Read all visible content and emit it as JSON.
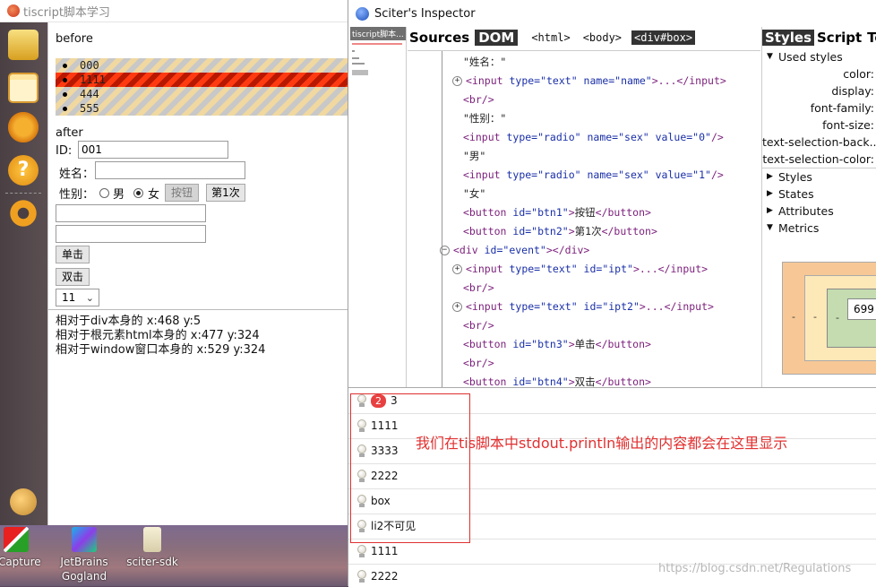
{
  "app": {
    "title": "tiscript脚本学习",
    "before_label": "before",
    "list_items": [
      "000",
      "1111",
      "444",
      "555"
    ],
    "after_label": "after",
    "id_label": "ID:",
    "id_value": "001",
    "name_label": "姓名：",
    "sex_label": "性别：",
    "sex_male": "男",
    "sex_female": "女",
    "btn1_label": "按钮",
    "btn2_label": "第1次",
    "single_click": "单击",
    "double_click": "双击",
    "select_value": "11",
    "log_lines": [
      "相对于div本身的 x:468 y:5",
      "相对于根元素html本身的 x:477 y:324",
      "相对于window窗口本身的 x:529 y:324"
    ]
  },
  "desktop_icons": [
    "SCapture",
    "JetBrains\nGogland",
    "sciter-sdk"
  ],
  "inspector": {
    "title": "Sciter's Inspector",
    "thumb_header": "tiscript脚本...",
    "tabs": {
      "sources": "Sources",
      "dom": "DOM"
    },
    "breadcrumbs": [
      "<html>",
      "<body>",
      "<div#box>"
    ],
    "dom_rows": [
      {
        "indent": 0,
        "expand": false,
        "parts": [
          [
            "text",
            "\"姓名：\""
          ]
        ]
      },
      {
        "indent": 0,
        "expand": true,
        "parts": [
          [
            "tag",
            "<input "
          ],
          [
            "attr",
            "type=\"text\" name=\"name\""
          ],
          [
            "tag",
            ">...</input>"
          ]
        ]
      },
      {
        "indent": 0,
        "expand": false,
        "parts": [
          [
            "tag",
            "<br/>"
          ]
        ]
      },
      {
        "indent": 0,
        "expand": false,
        "parts": [
          [
            "text",
            "\"性别：\""
          ]
        ]
      },
      {
        "indent": 0,
        "expand": false,
        "parts": [
          [
            "tag",
            "<input "
          ],
          [
            "attr",
            "type=\"radio\" name=\"sex\" value=\"0\""
          ],
          [
            "tag",
            "/>"
          ]
        ]
      },
      {
        "indent": 0,
        "expand": false,
        "parts": [
          [
            "text",
            "\"男\""
          ]
        ]
      },
      {
        "indent": 0,
        "expand": false,
        "parts": [
          [
            "tag",
            "<input "
          ],
          [
            "attr",
            "type=\"radio\" name=\"sex\" value=\"1\""
          ],
          [
            "tag",
            "/>"
          ]
        ]
      },
      {
        "indent": 0,
        "expand": false,
        "parts": [
          [
            "text",
            "\"女\""
          ]
        ]
      },
      {
        "indent": 0,
        "expand": false,
        "parts": [
          [
            "tag",
            "<button "
          ],
          [
            "attr",
            "id=\"btn1\""
          ],
          [
            "tag",
            ">"
          ],
          [
            "text",
            "按钮"
          ],
          [
            "tag",
            "</button>"
          ]
        ]
      },
      {
        "indent": 0,
        "expand": false,
        "parts": [
          [
            "tag",
            "<button "
          ],
          [
            "attr",
            "id=\"btn2\""
          ],
          [
            "tag",
            ">"
          ],
          [
            "text",
            "第1次"
          ],
          [
            "tag",
            "</button>"
          ]
        ]
      },
      {
        "indent": -1,
        "expand": "minus",
        "parts": [
          [
            "tag",
            "<div "
          ],
          [
            "attr",
            "id=\"event\""
          ],
          [
            "tag",
            "></div>"
          ]
        ]
      },
      {
        "indent": 0,
        "expand": true,
        "parts": [
          [
            "tag",
            "<input "
          ],
          [
            "attr",
            "type=\"text\" id=\"ipt\""
          ],
          [
            "tag",
            ">...</input>"
          ]
        ]
      },
      {
        "indent": 0,
        "expand": false,
        "parts": [
          [
            "tag",
            "<br/>"
          ]
        ]
      },
      {
        "indent": 0,
        "expand": true,
        "parts": [
          [
            "tag",
            "<input "
          ],
          [
            "attr",
            "type=\"text\" id=\"ipt2\""
          ],
          [
            "tag",
            ">...</input>"
          ]
        ]
      },
      {
        "indent": 0,
        "expand": false,
        "parts": [
          [
            "tag",
            "<br/>"
          ]
        ]
      },
      {
        "indent": 0,
        "expand": false,
        "parts": [
          [
            "tag",
            "<button "
          ],
          [
            "attr",
            "id=\"btn3\""
          ],
          [
            "tag",
            ">"
          ],
          [
            "text",
            "单击"
          ],
          [
            "tag",
            "</button>"
          ]
        ]
      },
      {
        "indent": 0,
        "expand": false,
        "parts": [
          [
            "tag",
            "<br/>"
          ]
        ]
      },
      {
        "indent": 0,
        "expand": false,
        "parts": [
          [
            "tag",
            "<button "
          ],
          [
            "attr",
            "id=\"btn4\""
          ],
          [
            "tag",
            ">"
          ],
          [
            "text",
            "双击"
          ],
          [
            "tag",
            "</button>"
          ]
        ]
      }
    ],
    "styles_tabs": [
      "Styles",
      "Script",
      "Tes"
    ],
    "used_styles_label": "Used styles",
    "used_props": [
      "color:",
      "display:",
      "font-family:",
      "font-size:",
      "text-selection-back...",
      "text-selection-color:"
    ],
    "sections": [
      "Styles",
      "States",
      "Attributes",
      "Metrics"
    ],
    "metrics_value": "699",
    "metrics_dash": "-",
    "console_rows": [
      {
        "badge": "2",
        "text": "3"
      },
      {
        "badge": "",
        "text": "1111"
      },
      {
        "badge": "",
        "text": "3333"
      },
      {
        "badge": "",
        "text": "2222"
      },
      {
        "badge": "",
        "text": "box"
      },
      {
        "badge": "",
        "text": "li2不可见"
      },
      {
        "badge": "",
        "text": "1111"
      },
      {
        "badge": "",
        "text": "2222"
      }
    ],
    "annotation": "我们在tis脚本中stdout.println输出的内容都会在这里显示",
    "watermark": "https://blog.csdn.net/Regulations"
  }
}
